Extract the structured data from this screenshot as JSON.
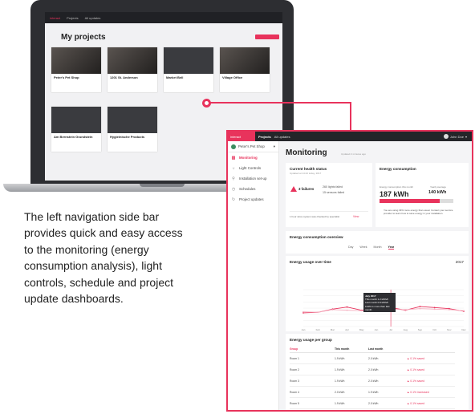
{
  "description": "The left navigation side bar provides quick and easy access to the monitoring (energy consumption analysis), light controls, schedule and project update dashboards.",
  "laptop": {
    "brand": "interact",
    "nav": [
      "Projects",
      "All updates"
    ],
    "title": "My projects",
    "cards": [
      {
        "name": "Peter's Pet Shop"
      },
      {
        "name": "1201 St. Anderson"
      },
      {
        "name": "Market Bell"
      },
      {
        "name": "Village Office"
      },
      {
        "name": "Am Bernstein Grundstein"
      },
      {
        "name": "Hygieinische Products"
      }
    ]
  },
  "app": {
    "brand": "interact",
    "nav": [
      "Projects",
      "All updates"
    ],
    "user": "John Doe",
    "project": "Peter's Pet Shop",
    "sidebar": [
      {
        "label": "Monitoring",
        "icon": "chart-icon",
        "active": true
      },
      {
        "label": "Light Controls",
        "icon": "bulb-icon",
        "active": false
      },
      {
        "label": "Installation set-up",
        "icon": "pin-icon",
        "active": false
      },
      {
        "label": "Schedules",
        "icon": "clock-icon",
        "active": false
      },
      {
        "label": "Project updates",
        "icon": "refresh-icon",
        "active": false
      }
    ],
    "page_title": "Monitoring",
    "page_sub": "Updated 2 minutes ago",
    "health": {
      "title": "Current health status",
      "sub": "Updated at 14:42 today, 2017",
      "failures": "3 failures",
      "line1": "260 lights failed",
      "line2": "15 sensors failed",
      "footer": "1 hour since system was checked by specialist",
      "link": "View"
    },
    "energy": {
      "title": "Energy consumption",
      "label_left": "Energy consumption this month",
      "value": "187 kWh",
      "label_right": "Yearly average",
      "value_right": "140 kWh",
      "fill": 0.82,
      "note": "You are using 34% more energy than usual. Contact your service provider to learn how to save energy in your installation."
    },
    "overview": {
      "title": "Energy consumption overview",
      "tabs": [
        "Day",
        "Week",
        "Month",
        "Year"
      ],
      "active_tab": "Year"
    },
    "usage": {
      "title": "Energy usage over time",
      "year": "2017",
      "tooltip_lines": [
        "July 2017",
        "This month    1.2 kWh/h",
        "Last month    0.9 kWh/h",
        "134% is more than last month"
      ]
    },
    "group": {
      "title": "Energy usage per group",
      "headers": [
        "Group",
        "This month",
        "Last month",
        ""
      ],
      "rows": [
        {
          "group": "Room 1",
          "this": "1.9 kWh",
          "last": "2.0 kWh",
          "delta": "0.1% saved"
        },
        {
          "group": "Room 2",
          "this": "1.9 kWh",
          "last": "2.0 kWh",
          "delta": "0.1% saved"
        },
        {
          "group": "Room 3",
          "this": "1.9 kWh",
          "last": "2.0 kWh",
          "delta": "0.1% saved"
        },
        {
          "group": "Room 4",
          "this": "2.0 kWh",
          "last": "1.9 kWh",
          "delta": "0.1% increased"
        },
        {
          "group": "Room 5",
          "this": "1.9 kWh",
          "last": "2.0 kWh",
          "delta": "0.1% saved"
        }
      ]
    }
  },
  "chart_data": {
    "type": "line",
    "categories": [
      "Jan",
      "Feb",
      "Mar",
      "Apr",
      "May",
      "Jun",
      "Jul",
      "Aug",
      "Sep",
      "Oct",
      "Nov",
      "Dec"
    ],
    "series": [
      {
        "name": "This month",
        "color": "#e8335c",
        "values": [
          2.6,
          2.7,
          3.3,
          3.7,
          3.1,
          3.4,
          3.6,
          3.1,
          3.8,
          3.6,
          3.4,
          2.9
        ]
      },
      {
        "name": "Last month",
        "color": "#f5b1c1",
        "values": [
          2.8,
          2.7,
          3.2,
          3.1,
          3.0,
          3.2,
          3.3,
          3.2,
          3.4,
          3.3,
          3.2,
          3.0
        ]
      }
    ],
    "ylim": [
      0,
      7
    ],
    "title": "Energy usage over time"
  }
}
